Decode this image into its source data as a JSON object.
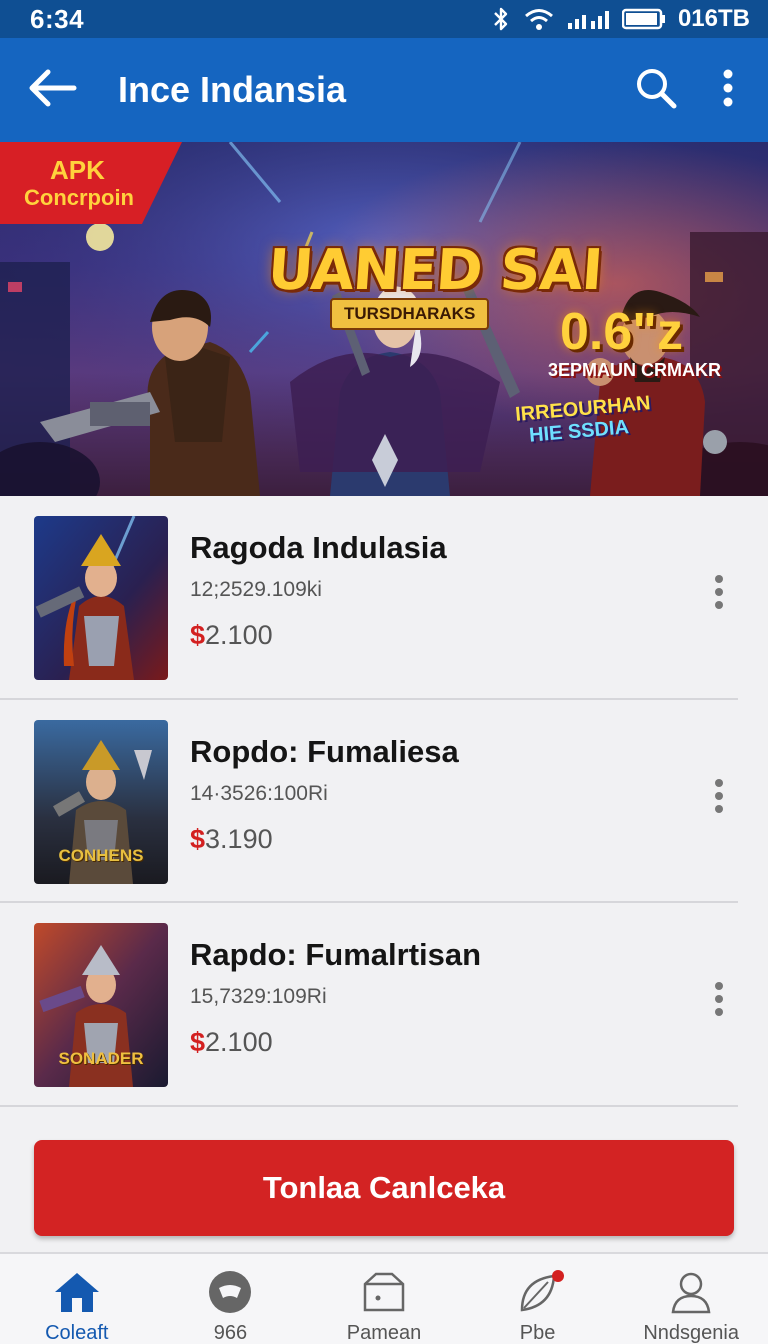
{
  "status_bar": {
    "time": "6:34",
    "right_text": "016TB",
    "icons": [
      "bluetooth-icon",
      "wifi-icon",
      "signal-icon",
      "battery-icon"
    ]
  },
  "app_bar": {
    "title": "Ince Indansia",
    "back_icon": "arrow-left-icon",
    "search_icon": "search-icon",
    "more_icon": "more-vertical-icon"
  },
  "banner": {
    "tag_line1": "APK",
    "tag_line2": "Concrpoin",
    "logo_main": "UANED SAI",
    "logo_sub": "TURSDHARAKS",
    "price": "0.6\"z",
    "price_sub": "3EPMAUN CRMAKR",
    "badge_line1": "IRREOURHAN",
    "badge_line2": "HIE SSDIA"
  },
  "items": [
    {
      "name": "Ragoda Indulasia",
      "meta": "12;2529.109ki",
      "currency": "$",
      "price": "2.100",
      "thumb_label": ""
    },
    {
      "name": "Ropdo: Fumaliesa",
      "meta": "14·3526:100Ri",
      "currency": "$",
      "price": "3.190",
      "thumb_label": "CONHENS"
    },
    {
      "name": "Rapdo: Fumalrtisan",
      "meta": "15,7329:109Ri",
      "currency": "$",
      "price": "2.100",
      "thumb_label": "SONADER"
    }
  ],
  "cta": {
    "label": "Tonlaa Canlceka"
  },
  "bottom_nav": [
    {
      "label": "Coleaft",
      "icon": "home-icon",
      "active": true
    },
    {
      "label": "966",
      "icon": "game-controller-icon",
      "active": false
    },
    {
      "label": "Pamean",
      "icon": "folder-icon",
      "active": false
    },
    {
      "label": "Pbe",
      "icon": "leaf-icon",
      "active": false,
      "badge": true
    },
    {
      "label": "Nndsgenia",
      "icon": "user-icon",
      "active": false
    }
  ],
  "colors": {
    "status_bar": "#0f4f93",
    "app_bar": "#1565c0",
    "accent_red": "#d32323",
    "active_nav": "#1459b0"
  }
}
